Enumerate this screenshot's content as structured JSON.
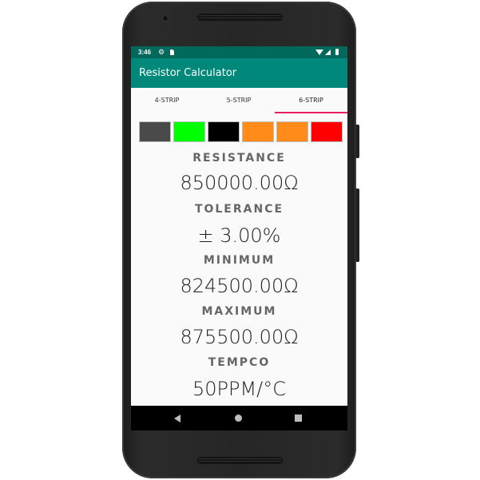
{
  "status_bar": {
    "time": "3:46",
    "icons": [
      "gear-icon",
      "sd-card-icon",
      "wifi-icon",
      "signal-icon",
      "battery-icon"
    ]
  },
  "app_bar": {
    "title": "Resistor Calculator"
  },
  "tabs": [
    {
      "label": "4-STRIP",
      "selected": false
    },
    {
      "label": "5-STRIP",
      "selected": false
    },
    {
      "label": "6-STRIP",
      "selected": true
    }
  ],
  "colors": {
    "status_bar": "#00695c",
    "app_bar": "#00897b",
    "tab_indicator": "#e91e63"
  },
  "color_strips": [
    {
      "color": "#4a4a4a"
    },
    {
      "color": "#00ff00"
    },
    {
      "color": "#000000"
    },
    {
      "color": "#ff8c1a"
    },
    {
      "color": "#ff8c1a"
    },
    {
      "color": "#ff0000"
    }
  ],
  "results": {
    "resistance_label": "RESISTANCE",
    "resistance_value": "850000.00Ω",
    "tolerance_label": "TOLERANCE",
    "tolerance_value": "± 3.00%",
    "minimum_label": "MINIMUM",
    "minimum_value": "824500.00Ω",
    "maximum_label": "MAXIMUM",
    "maximum_value": "875500.00Ω",
    "tempco_label": "TEMPCO",
    "tempco_value": "50PPM/°C"
  },
  "nav_bar": {
    "icons": [
      "back-icon",
      "home-icon",
      "recents-icon"
    ]
  }
}
